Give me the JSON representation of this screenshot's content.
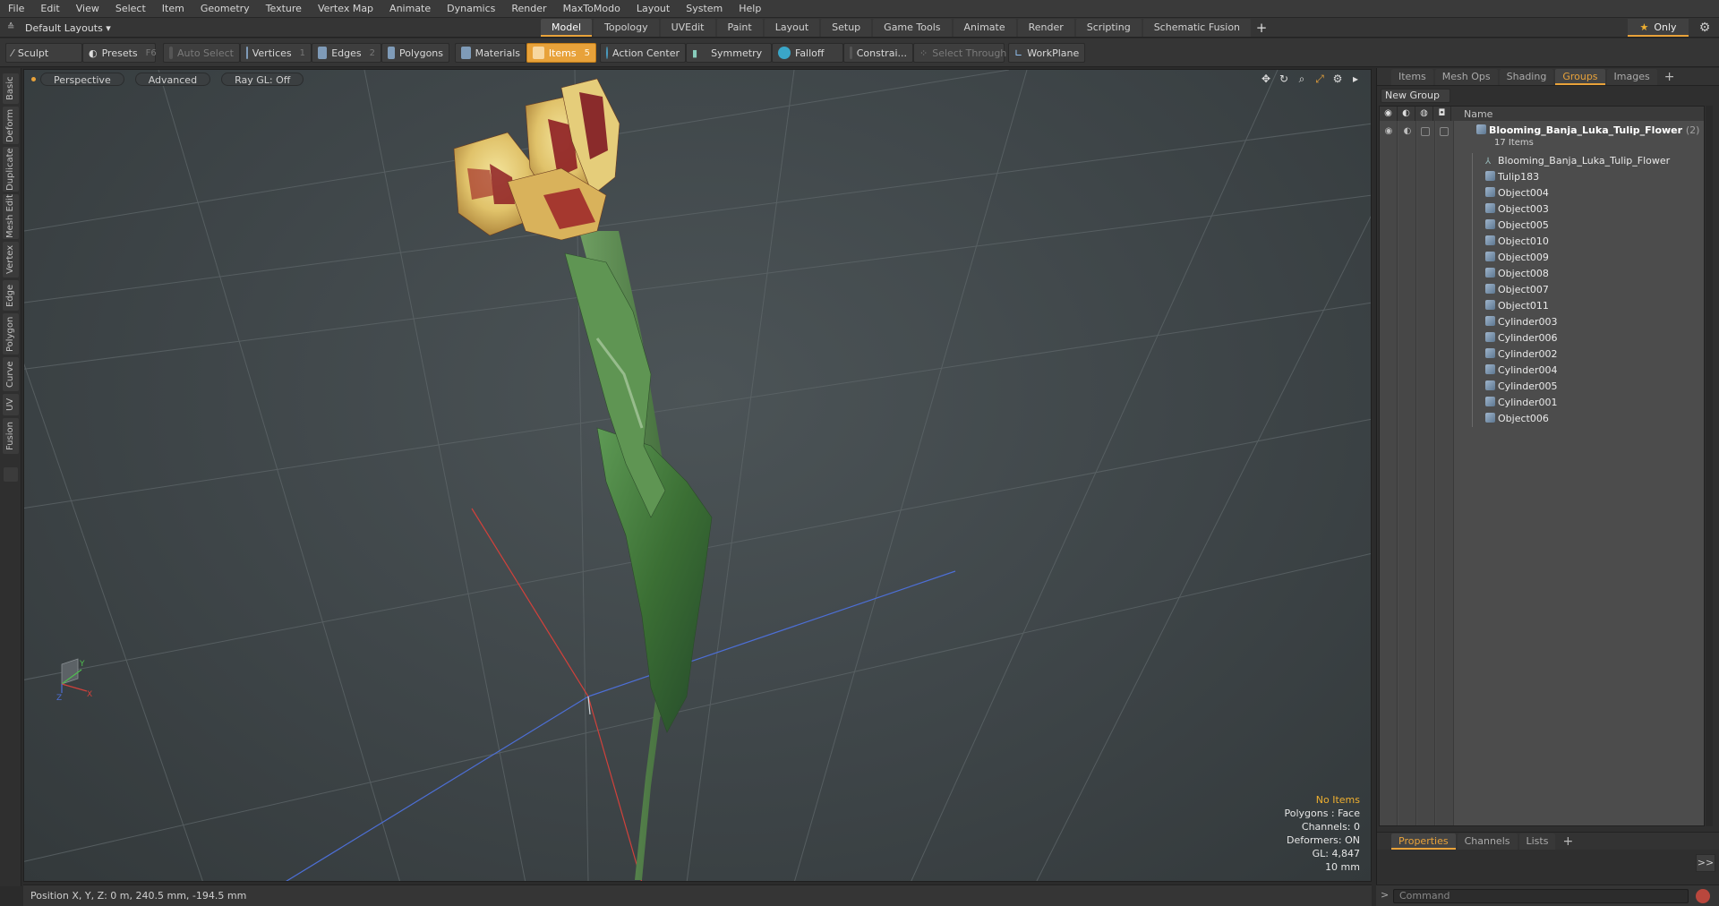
{
  "menu": [
    "File",
    "Edit",
    "View",
    "Select",
    "Item",
    "Geometry",
    "Texture",
    "Vertex Map",
    "Animate",
    "Dynamics",
    "Render",
    "MaxToModo",
    "Layout",
    "System",
    "Help"
  ],
  "layout": {
    "label": "Default Layouts ▾"
  },
  "tabs": [
    "Model",
    "Topology",
    "UVEdit",
    "Paint",
    "Layout",
    "Setup",
    "Game Tools",
    "Animate",
    "Render",
    "Scripting",
    "Schematic Fusion"
  ],
  "active_tab": "Model",
  "only_label": "Only",
  "toolbar": {
    "sculpt": "Sculpt",
    "presets": "Presets",
    "presets_key": "F6",
    "auto_select": "Auto Select",
    "vertices": "Vertices",
    "vertices_key": "1",
    "edges": "Edges",
    "edges_key": "2",
    "polygons": "Polygons",
    "materials": "Materials",
    "items": "Items",
    "items_key": "5",
    "action_center": "Action Center",
    "symmetry": "Symmetry",
    "falloff": "Falloff",
    "constrain": "Constrai...",
    "select_through": "Select Through",
    "workplane": "WorkPlane"
  },
  "left_tabs": [
    "Basic",
    "Deform",
    "Duplicate",
    "Mesh Edit",
    "Vertex",
    "Edge",
    "Polygon",
    "Curve",
    "UV",
    "Fusion"
  ],
  "viewport": {
    "view": "Perspective",
    "mode": "Advanced",
    "raygl": "Ray GL: Off",
    "info": {
      "no_items": "No Items",
      "polygons": "Polygons : Face",
      "channels": "Channels: 0",
      "deformers": "Deformers: ON",
      "gl": "GL: 4,847",
      "scale": "10 mm"
    },
    "axis_labels": {
      "x": "X",
      "y": "Y",
      "z": "Z"
    }
  },
  "right_panel": {
    "tabs": [
      "Items",
      "Mesh Ops",
      "Shading",
      "Groups",
      "Images"
    ],
    "active_tab": "Groups",
    "new_group": "New Group",
    "col_name": "Name",
    "group": {
      "name": "Blooming_Banja_Luka_Tulip_Flower",
      "count": "(2)",
      "sub": "17 Items"
    },
    "items": [
      {
        "name": "Blooming_Banja_Luka_Tulip_Flower",
        "icon": "locator"
      },
      {
        "name": "Tulip183",
        "icon": "mesh"
      },
      {
        "name": "Object004",
        "icon": "mesh"
      },
      {
        "name": "Object003",
        "icon": "mesh"
      },
      {
        "name": "Object005",
        "icon": "mesh"
      },
      {
        "name": "Object010",
        "icon": "mesh"
      },
      {
        "name": "Object009",
        "icon": "mesh"
      },
      {
        "name": "Object008",
        "icon": "mesh"
      },
      {
        "name": "Object007",
        "icon": "mesh"
      },
      {
        "name": "Object011",
        "icon": "mesh"
      },
      {
        "name": "Cylinder003",
        "icon": "mesh"
      },
      {
        "name": "Cylinder006",
        "icon": "mesh"
      },
      {
        "name": "Cylinder002",
        "icon": "mesh"
      },
      {
        "name": "Cylinder004",
        "icon": "mesh"
      },
      {
        "name": "Cylinder005",
        "icon": "mesh"
      },
      {
        "name": "Cylinder001",
        "icon": "mesh"
      },
      {
        "name": "Object006",
        "icon": "mesh"
      }
    ],
    "bottom_tabs": [
      "Properties",
      "Channels",
      "Lists"
    ],
    "bottom_active": "Properties",
    "expand": ">>"
  },
  "status": {
    "position": "Position X, Y, Z:   0 m, 240.5 mm, -194.5 mm"
  },
  "command": {
    "placeholder": "Command"
  },
  "colors": {
    "accent": "#e8a23a",
    "petal_red": "#8e1f24",
    "petal_yellow": "#e9d27a",
    "leaf": "#3f7a3a"
  }
}
